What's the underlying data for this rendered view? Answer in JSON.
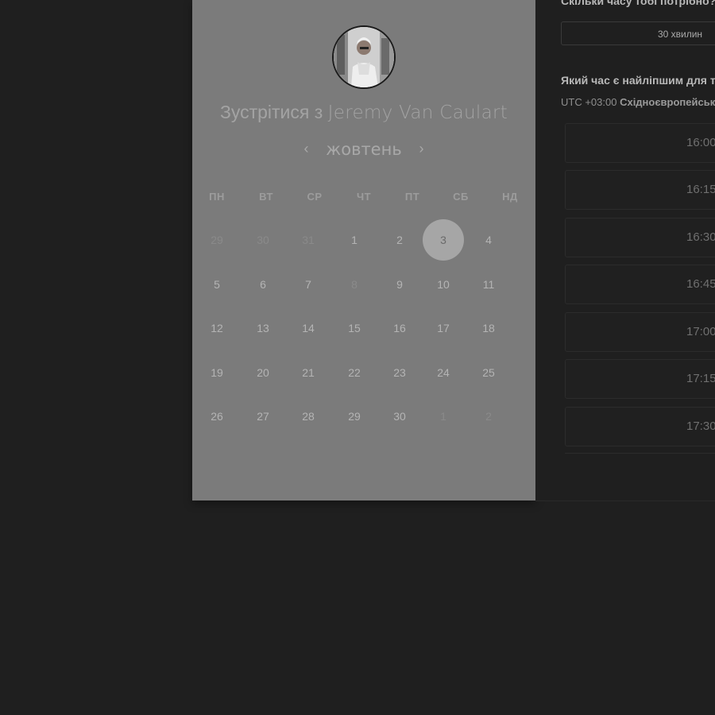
{
  "duration_question": "Скільки часу тобі потрібно?",
  "duration_value": "30 хвилин",
  "time_question": "Який час є найліпшим для тебе?",
  "timezone": {
    "offset": "UTC +03:00",
    "name": "Східноєвропейський час"
  },
  "meeting_title": {
    "prefix": "Зустрітися з",
    "person": "Jeremy Van Caulart"
  },
  "month": "жовтень",
  "nav": {
    "prev": "‹",
    "next": "›"
  },
  "weekdays": [
    "ПН",
    "ВТ",
    "СР",
    "ЧТ",
    "ПТ",
    "СБ",
    "НД"
  ],
  "weeks": [
    [
      {
        "d": "29",
        "m": true
      },
      {
        "d": "30",
        "m": true
      },
      {
        "d": "31",
        "m": true
      },
      {
        "d": "1"
      },
      {
        "d": "2"
      },
      {
        "d": "3",
        "s": true
      },
      {
        "d": "4"
      }
    ],
    [
      {
        "d": "5"
      },
      {
        "d": "6"
      },
      {
        "d": "7"
      },
      {
        "d": "8",
        "m": true
      },
      {
        "d": "9"
      },
      {
        "d": "10"
      },
      {
        "d": "11"
      }
    ],
    [
      {
        "d": "12"
      },
      {
        "d": "13"
      },
      {
        "d": "14"
      },
      {
        "d": "15"
      },
      {
        "d": "16"
      },
      {
        "d": "17"
      },
      {
        "d": "18"
      }
    ],
    [
      {
        "d": "19"
      },
      {
        "d": "20"
      },
      {
        "d": "21"
      },
      {
        "d": "22"
      },
      {
        "d": "23"
      },
      {
        "d": "24"
      },
      {
        "d": "25"
      }
    ],
    [
      {
        "d": "26"
      },
      {
        "d": "27"
      },
      {
        "d": "28"
      },
      {
        "d": "29"
      },
      {
        "d": "30"
      },
      {
        "d": "1",
        "m": true
      },
      {
        "d": "2",
        "m": true
      }
    ]
  ],
  "time_slots": [
    "16:00",
    "16:15",
    "16:30",
    "16:45",
    "17:00",
    "17:15",
    "17:30"
  ]
}
